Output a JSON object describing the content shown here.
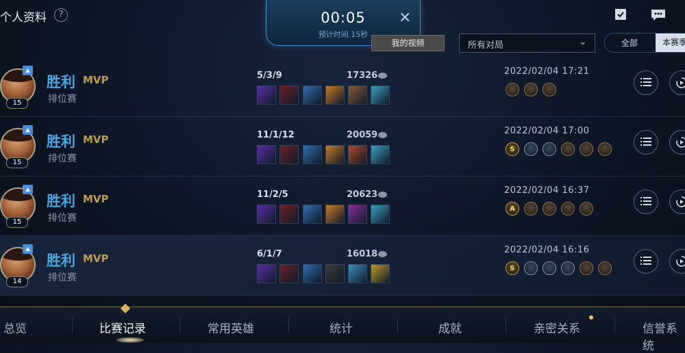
{
  "header": {
    "title": "个人资料",
    "help_icon": "?",
    "timer": {
      "time": "00:05",
      "estimate": "预计时间 15秒"
    },
    "my_video_button": "我的视频",
    "filter_dropdown": {
      "selected": "所有对局"
    },
    "segments": {
      "all": "全部",
      "season": "本赛季"
    }
  },
  "matches": [
    {
      "result": "胜利",
      "mvp": "MVP",
      "mode": "排位赛",
      "level": "15",
      "kda": "5/3/9",
      "gold": "17326",
      "time": "2022/02/04 17:21",
      "medals": [
        {
          "k": "plain",
          "t": ""
        },
        {
          "k": "plain",
          "t": ""
        },
        {
          "k": "plain",
          "t": ""
        }
      ]
    },
    {
      "result": "胜利",
      "mvp": "MVP",
      "mode": "排位赛",
      "level": "15",
      "kda": "11/1/12",
      "gold": "20059",
      "time": "2022/02/04 17:00",
      "medals": [
        {
          "k": "gold",
          "t": "S"
        },
        {
          "k": "blue",
          "t": ""
        },
        {
          "k": "blue",
          "t": ""
        },
        {
          "k": "plain",
          "t": ""
        },
        {
          "k": "plain",
          "t": ""
        },
        {
          "k": "plain",
          "t": ""
        }
      ]
    },
    {
      "result": "胜利",
      "mvp": "MVP",
      "mode": "排位赛",
      "level": "15",
      "kda": "11/2/5",
      "gold": "20623",
      "time": "2022/02/04 16:37",
      "medals": [
        {
          "k": "gold",
          "t": "A"
        },
        {
          "k": "plain",
          "t": ""
        },
        {
          "k": "plain",
          "t": ""
        },
        {
          "k": "plain",
          "t": ""
        },
        {
          "k": "plain",
          "t": ""
        }
      ]
    },
    {
      "result": "胜利",
      "mvp": "MVP",
      "mode": "排位赛",
      "level": "14",
      "kda": "6/1/7",
      "gold": "16018",
      "time": "2022/02/04 16:16",
      "medals": [
        {
          "k": "gold",
          "t": "S"
        },
        {
          "k": "blue",
          "t": ""
        },
        {
          "k": "blue",
          "t": ""
        },
        {
          "k": "blue",
          "t": ""
        },
        {
          "k": "plain",
          "t": ""
        },
        {
          "k": "plain",
          "t": ""
        }
      ]
    }
  ],
  "item_colors": [
    [
      "#5b2fa8",
      "#6d1f2b",
      "#2f6fb0",
      "#c57b2e",
      "#8a5a36",
      "#3aa0c4"
    ],
    [
      "#5b2fa8",
      "#6d1f2b",
      "#2f6fb0",
      "#c57b2e",
      "#b04a2a",
      "#3aa0c4"
    ],
    [
      "#5b2fa8",
      "#6d1f2b",
      "#2f6fb0",
      "#c57b2e",
      "#8b2f9c",
      "#3aa0c4"
    ],
    [
      "#5b2fa8",
      "#6d1f2b",
      "#2f6fb0",
      "#3a3a3a",
      "#3b8fc0",
      "#c09a2c"
    ]
  ],
  "bottom_nav": [
    "总览",
    "比赛记录",
    "常用英雄",
    "统计",
    "成就",
    "亲密关系",
    "信誉系统"
  ],
  "bottom_nav_active": "比赛记录"
}
